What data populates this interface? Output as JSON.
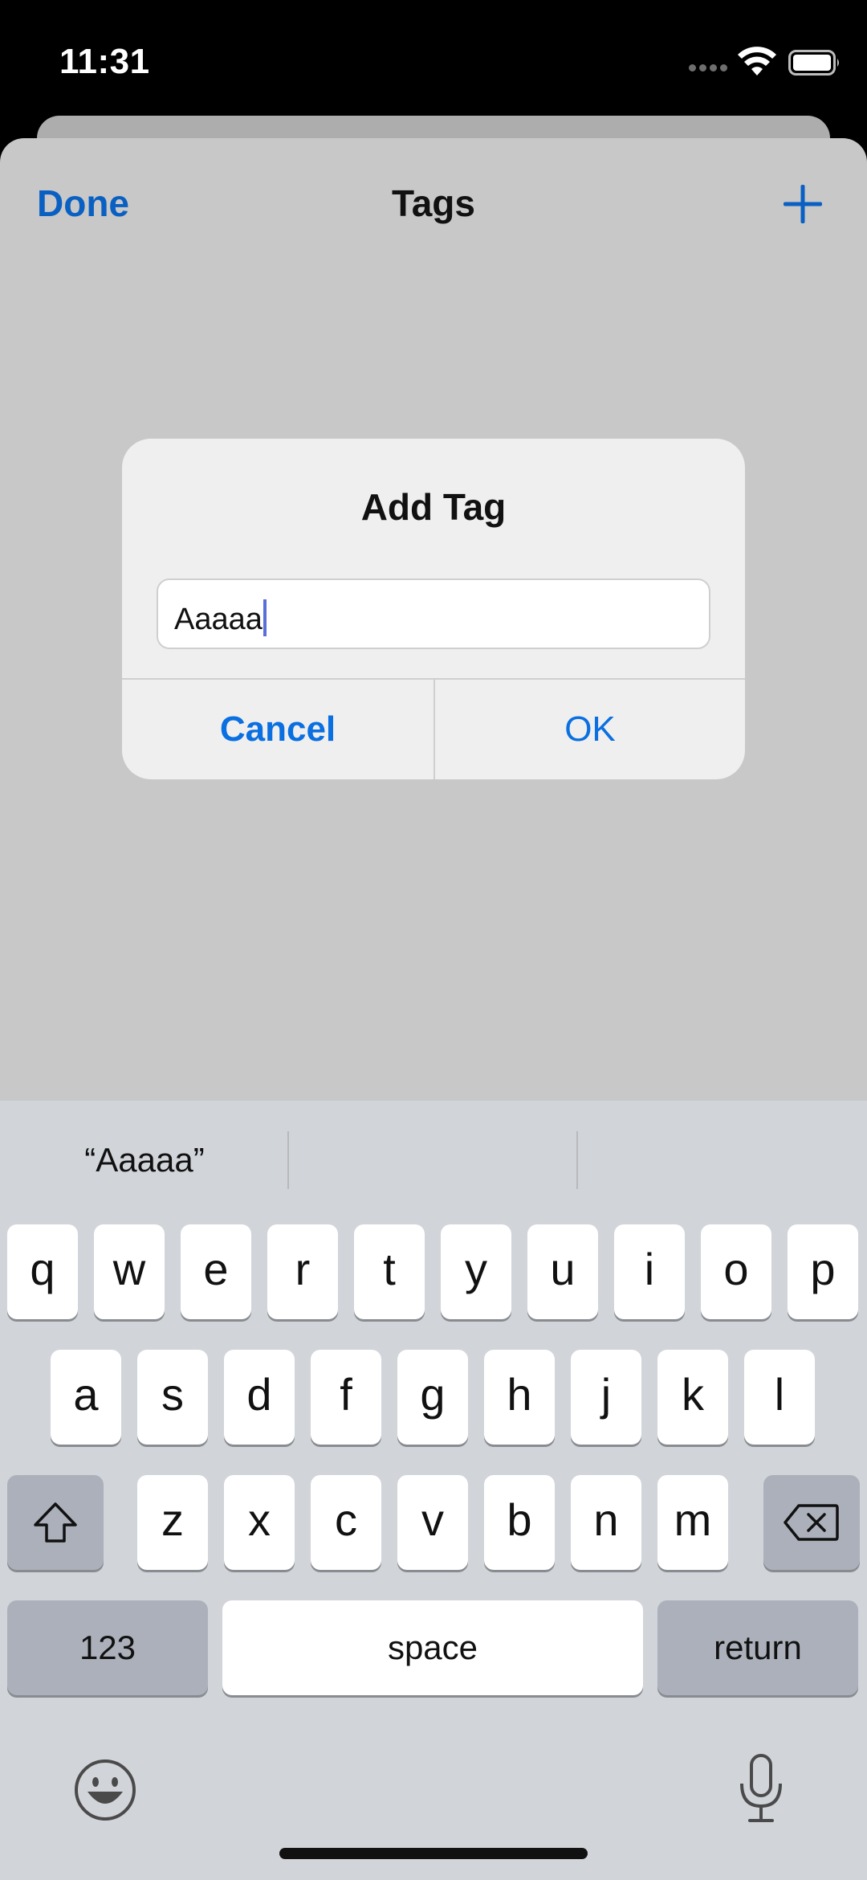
{
  "status_bar": {
    "time": "11:31"
  },
  "nav": {
    "done_label": "Done",
    "title": "Tags",
    "add_icon": "plus-icon"
  },
  "alert": {
    "title": "Add Tag",
    "input_value": "Aaaaa",
    "cancel_label": "Cancel",
    "ok_label": "OK"
  },
  "keyboard": {
    "suggestions": [
      "“Aaaaa”",
      "",
      ""
    ],
    "row1": [
      "q",
      "w",
      "e",
      "r",
      "t",
      "y",
      "u",
      "i",
      "o",
      "p"
    ],
    "row2": [
      "a",
      "s",
      "d",
      "f",
      "g",
      "h",
      "j",
      "k",
      "l"
    ],
    "row3": [
      "z",
      "x",
      "c",
      "v",
      "b",
      "n",
      "m"
    ],
    "numbers_label": "123",
    "space_label": "space",
    "return_label": "return",
    "shift_icon": "shift-icon",
    "delete_icon": "delete-icon",
    "emoji_icon": "emoji-icon",
    "mic_icon": "microphone-icon"
  },
  "colors": {
    "accent": "#0a6fe0",
    "nav_accent": "#0a60c2",
    "sheet_bg": "#c8c8c8",
    "keyboard_bg": "#d1d4d9"
  }
}
